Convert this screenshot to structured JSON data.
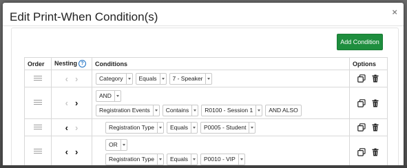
{
  "dialog": {
    "title": "Edit Print-When Condition(s)",
    "close_symbol": "×",
    "add_condition_label": "Add Condition"
  },
  "table": {
    "headers": {
      "order": "Order",
      "nesting": "Nesting",
      "conditions": "Conditions",
      "options": "Options"
    },
    "help_symbol": "?"
  },
  "rows": [
    {
      "nest_left_active": false,
      "nest_right_active": false,
      "lines": [
        {
          "field": "Category",
          "operator": "Equals",
          "value": "7 - Speaker"
        }
      ]
    },
    {
      "nest_left_active": false,
      "nest_right_active": true,
      "connector": "AND",
      "lines": [
        {
          "field": "Registration Events",
          "operator": "Contains",
          "value": "R0100 - Session 1",
          "suffix": "AND ALSO"
        }
      ]
    },
    {
      "nest_left_active": true,
      "nest_right_active": false,
      "lines": [
        {
          "field": "Registration Type",
          "operator": "Equals",
          "value": "P0005 - Student"
        }
      ]
    },
    {
      "nest_left_active": true,
      "nest_right_active": true,
      "connector": "OR",
      "lines": [
        {
          "field": "Registration Type",
          "operator": "Equals",
          "value": "P0010 - VIP"
        }
      ]
    }
  ],
  "colors": {
    "add_button": "#1e8e3e",
    "help_icon": "#1a6fc4"
  },
  "icons": {
    "drag": "drag-handle-icon",
    "copy": "copy-icon",
    "delete": "trash-icon",
    "nest_left": "chevron-left-icon",
    "nest_right": "chevron-right-icon",
    "help": "help-circle-icon",
    "close": "close-icon"
  }
}
